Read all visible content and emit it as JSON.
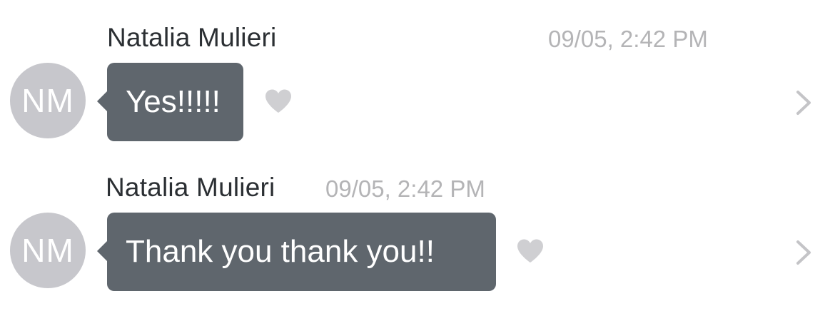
{
  "messages": [
    {
      "sender": "Natalia Mulieri",
      "timestamp": "09/05, 2:42 PM",
      "avatar_initials": "NM",
      "text": "Yes!!!!!"
    },
    {
      "sender": "Natalia Mulieri",
      "timestamp": "09/05, 2:42 PM",
      "avatar_initials": "NM",
      "text": "Thank you thank you!!"
    }
  ],
  "icons": {
    "like": "heart-icon",
    "details": "chevron-right-icon"
  },
  "colors": {
    "bubble": "#5f666d",
    "avatar": "#c7c7cc",
    "heart": "#cfcfd2",
    "chevron": "#c4c4c7",
    "timestamp": "#b4b4b6"
  }
}
